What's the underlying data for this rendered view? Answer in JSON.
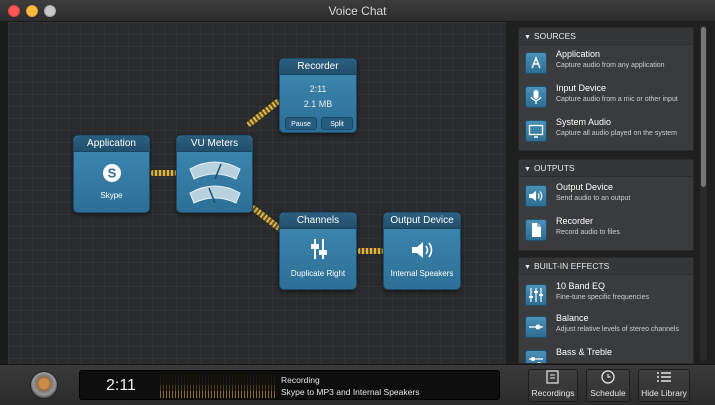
{
  "window": {
    "title": "Voice Chat"
  },
  "nodes": {
    "application": {
      "title": "Application",
      "label": "Skype",
      "icon": "skype-icon"
    },
    "vu_meters": {
      "title": "VU Meters",
      "icon": "vu-meter-icon"
    },
    "recorder": {
      "title": "Recorder",
      "time": "2:11",
      "size": "2.1 MB",
      "pause_label": "Pause",
      "split_label": "Split"
    },
    "channels": {
      "title": "Channels",
      "label": "Duplicate Right",
      "icon": "channels-icon"
    },
    "output_device": {
      "title": "Output Device",
      "label": "Internal Speakers",
      "icon": "speaker-icon"
    }
  },
  "library": {
    "sources": {
      "header": "SOURCES",
      "items": [
        {
          "title": "Application",
          "desc": "Capture audio from any application",
          "icon": "application-icon"
        },
        {
          "title": "Input Device",
          "desc": "Capture audio from a mic or other input",
          "icon": "microphone-icon"
        },
        {
          "title": "System Audio",
          "desc": "Capture all audio played on the system",
          "icon": "monitor-icon"
        }
      ]
    },
    "outputs": {
      "header": "OUTPUTS",
      "items": [
        {
          "title": "Output Device",
          "desc": "Send audio to an output",
          "icon": "speaker-icon"
        },
        {
          "title": "Recorder",
          "desc": "Record audio to files",
          "icon": "document-icon"
        }
      ]
    },
    "effects": {
      "header": "BUILT-IN EFFECTS",
      "items": [
        {
          "title": "10 Band EQ",
          "desc": "Fine-tune specific frequencies",
          "icon": "eq-icon"
        },
        {
          "title": "Balance",
          "desc": "Adjust relative levels of stereo channels",
          "icon": "balance-icon"
        },
        {
          "title": "Bass & Treble",
          "desc": "",
          "icon": "bass-treble-icon"
        }
      ]
    }
  },
  "status": {
    "time": "2:11",
    "title": "Recording",
    "subtitle": "Skype to MP3 and Internal Speakers"
  },
  "toolbar": {
    "recordings_label": "Recordings",
    "schedule_label": "Schedule",
    "hide_library_label": "Hide Library"
  },
  "colors": {
    "node_blue": "#3e8ab3",
    "cable_gold": "#d9b84a",
    "record_orange": "#c98d4a"
  }
}
